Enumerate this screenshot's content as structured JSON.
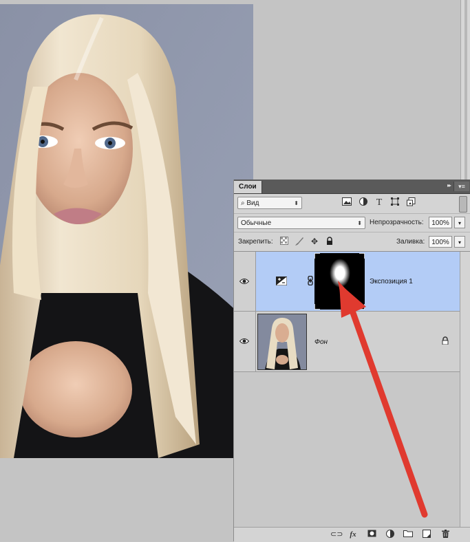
{
  "panel": {
    "tab_label": "Слои",
    "collapse_glyph": "▸▸",
    "menu_glyph": "▾≡",
    "filter": {
      "icon": "search-icon",
      "value": "Вид"
    },
    "filter_icons": [
      "image-filter-icon",
      "adjustment-filter-icon",
      "type-filter-icon",
      "shape-filter-icon",
      "smart-object-filter-icon"
    ],
    "blend_mode": "Обычные",
    "opacity_label": "Непрозрачность:",
    "opacity_value": "100%",
    "lock_label": "Закрепить:",
    "lock_icons": [
      "lock-transparent-icon",
      "lock-image-icon",
      "lock-position-icon",
      "lock-all-icon"
    ],
    "fill_label": "Заливка:",
    "fill_value": "100%"
  },
  "layers": [
    {
      "name": "Экспозиция 1",
      "type": "adjustment",
      "adjustment_icon": "exposure-icon",
      "selected": true,
      "visible": true,
      "has_mask": true,
      "linked": true
    },
    {
      "name": "Фон",
      "type": "background",
      "selected": false,
      "visible": true,
      "locked": true
    }
  ],
  "footer_icons": [
    "link-layers-icon",
    "fx-icon",
    "add-mask-icon",
    "new-adjustment-icon",
    "new-group-icon",
    "new-layer-icon",
    "delete-layer-icon"
  ],
  "footer_fx_label": "fx",
  "annotation": {
    "kind": "arrow",
    "color": "#e03a2f"
  },
  "colors": {
    "selection": "#b3ccf6",
    "panel_bg": "#d4d4d4",
    "tab_bar": "#5a5a5a",
    "arrow": "#e03a2f"
  }
}
